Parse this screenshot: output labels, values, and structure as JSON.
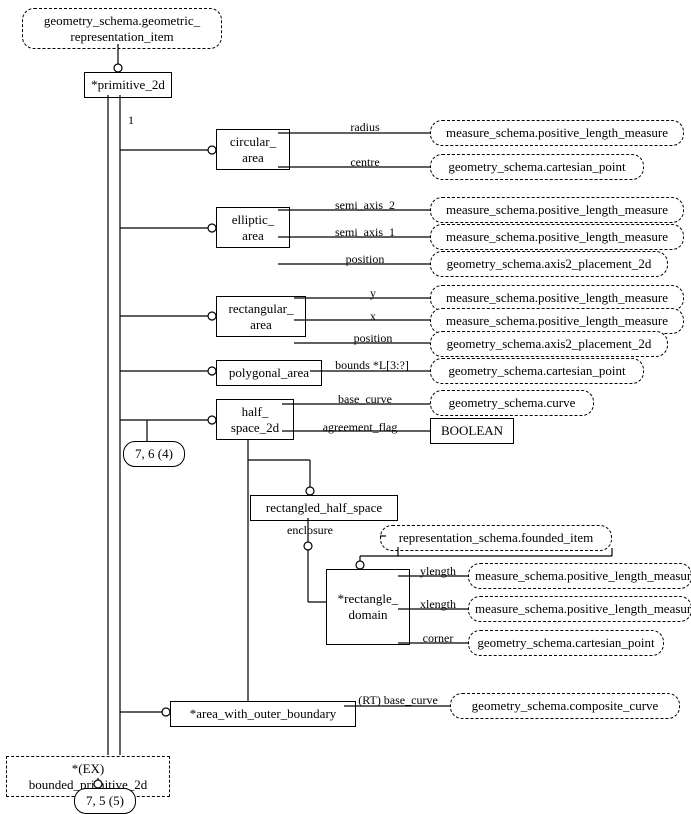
{
  "root": {
    "geom_repr_item": "geometry_schema.geometric_\nrepresentation_item",
    "primitive_2d": "*primitive_2d",
    "one": "1",
    "ref_7_6_4": "7, 6 (4)",
    "bounded_primitive_2d": "*(EX) bounded_primitive_2d",
    "ref_7_5_5": "7, 5 (5)",
    "area_with_outer_boundary": "*area_with_outer_boundary"
  },
  "entities": {
    "circular_area": "circular_\narea",
    "elliptic_area": "elliptic_\narea",
    "rectangular_area": "rectangular_\narea",
    "polygonal_area": "polygonal_area",
    "half_space_2d": "half_\nspace_2d",
    "rectangled_half_space": "rectangled_half_space",
    "rectangle_domain": "*rectangle_\ndomain"
  },
  "attrs": {
    "radius": "radius",
    "centre": "centre",
    "semi_axis_2": "semi_axis_2",
    "semi_axis_1": "semi_axis_1",
    "position": "position",
    "y": "y",
    "x": "x",
    "bounds": "bounds *L[3:?]",
    "base_curve": "base_curve",
    "agreement_flag": "agreement_flag",
    "enclosure": "enclosure",
    "ylength": "ylength",
    "xlength": "xlength",
    "corner": "corner",
    "rt_base_curve": "(RT) base_curve"
  },
  "targets": {
    "positive_length_measure": "measure_schema.positive_length_measure",
    "cartesian_point": "geometry_schema.cartesian_point",
    "axis2_placement_2d": "geometry_schema.axis2_placement_2d",
    "curve": "geometry_schema.curve",
    "boolean": "BOOLEAN",
    "founded_item": "representation_schema.founded_item",
    "composite_curve": "geometry_schema.composite_curve"
  }
}
